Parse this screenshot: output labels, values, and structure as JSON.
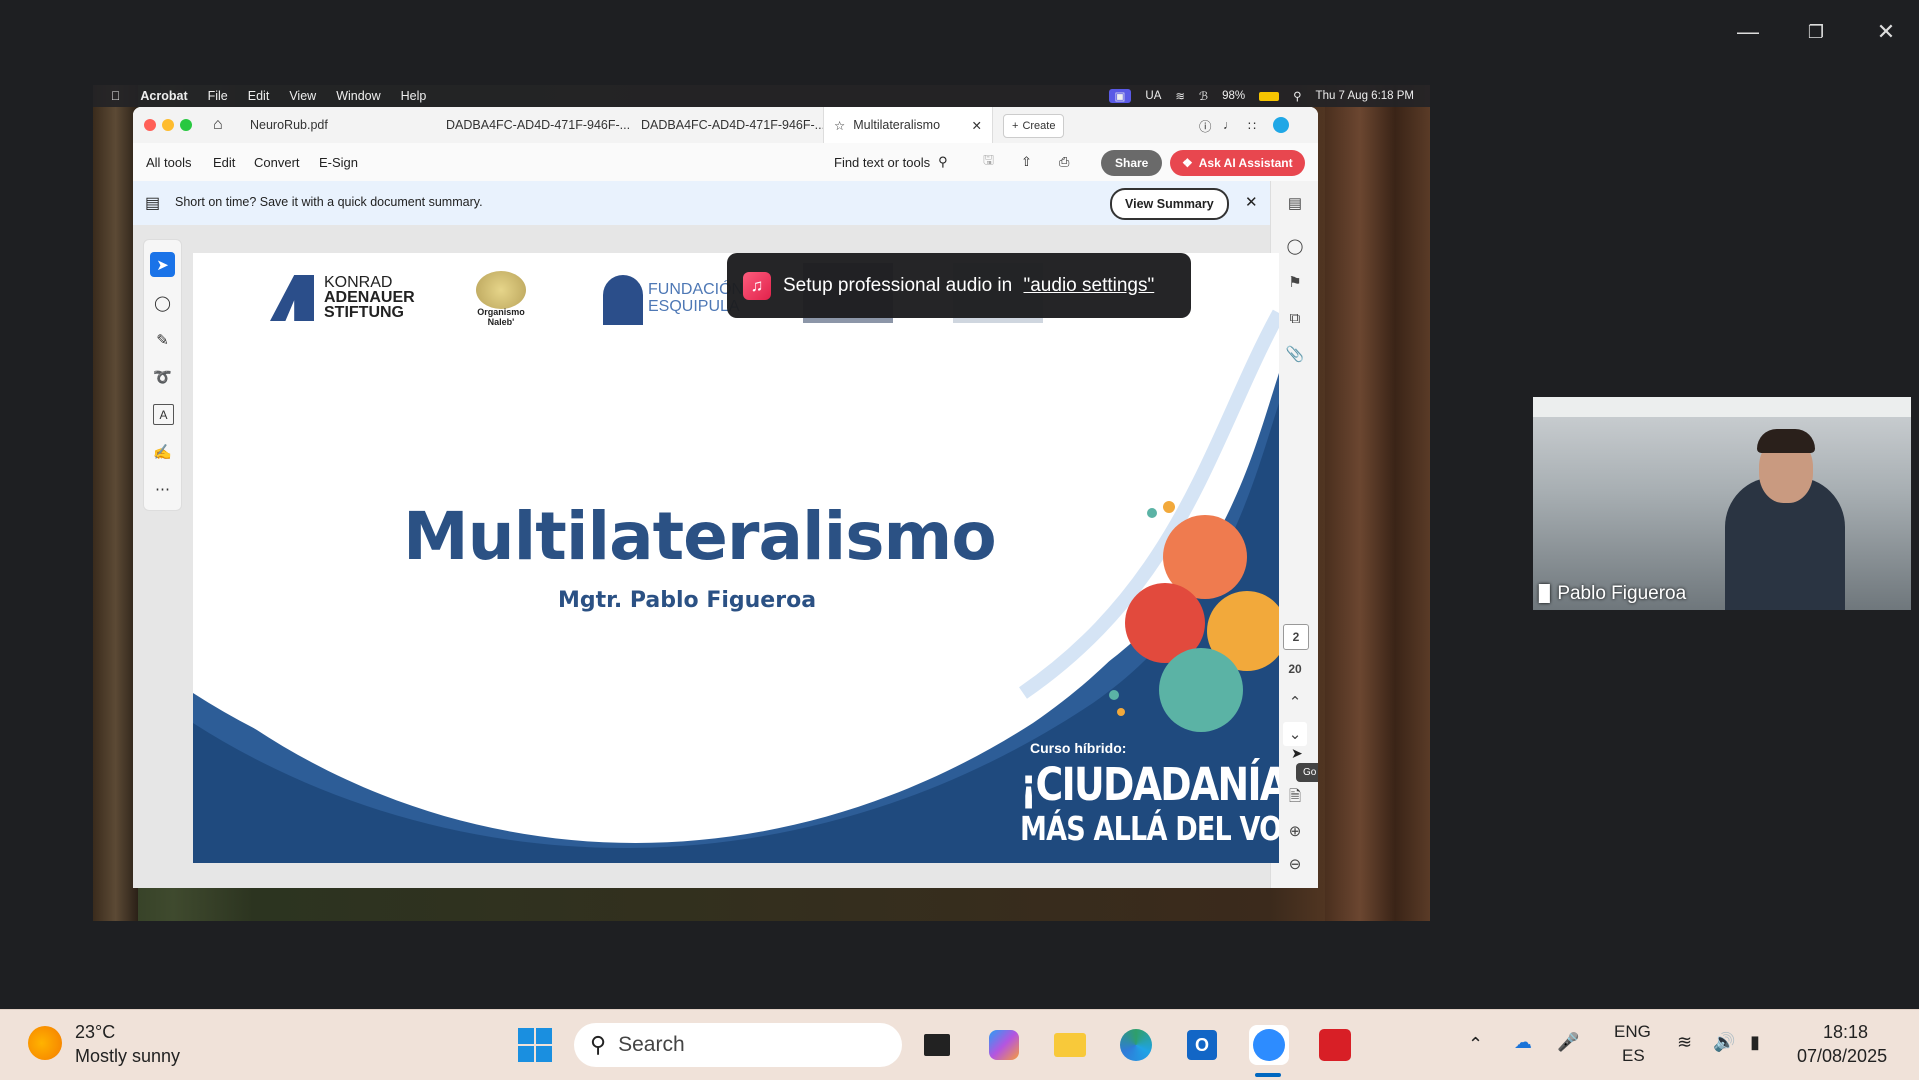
{
  "zoom_window": {
    "controls": {
      "minimize": "minimize-icon",
      "restore": "restore-icon",
      "close": "close-icon"
    }
  },
  "mac_menubar": {
    "items": [
      "Acrobat",
      "File",
      "Edit",
      "View",
      "Window",
      "Help"
    ],
    "status": {
      "flag": "UA",
      "battery": "98%",
      "datetime": "Thu 7 Aug  6:18 PM"
    }
  },
  "acrobat": {
    "tabs": [
      {
        "label": "NeuroRub.pdf"
      },
      {
        "label": "DADBA4FC-AD4D-471F-946F-..."
      },
      {
        "label": "DADBA4FC-AD4D-471F-946F-..."
      },
      {
        "label": "Multilateralismo"
      }
    ],
    "create_label": "Create",
    "toolbar": {
      "menu": [
        "All tools",
        "Edit",
        "Convert",
        "E-Sign"
      ],
      "find_label": "Find text or tools",
      "share_label": "Share",
      "ai_label": "Ask AI Assistant"
    },
    "summary_bar": {
      "message": "Short on time? Save it with a quick document summary.",
      "button": "View Summary"
    },
    "page_nav": {
      "current_page": "2",
      "total_pages": "20",
      "tooltip": "Go to next page (→)"
    }
  },
  "slide": {
    "logos": {
      "konrad": [
        "KONRAD",
        "ADENAUER",
        "STIFTUNG"
      ],
      "naleb": [
        "Organismo",
        "Naleb'"
      ],
      "fundacion": [
        "FUNDACIÓN",
        "ESQUIPULA"
      ]
    },
    "title": "Multilateralismo",
    "subtitle": "Mgtr. Pablo Figueroa",
    "course_label": "Curso híbrido:",
    "course_title_1": "¡CIUDADANÍA",
    "course_title_2": "MÁS ALLÁ DEL VOTO!",
    "colors": {
      "title": "#2b5184",
      "wave": "#2d5d97"
    }
  },
  "toast": {
    "text": "Setup professional audio in ",
    "link": "\"audio settings\""
  },
  "participant": {
    "name": "Pablo Figueroa"
  },
  "taskbar": {
    "weather": {
      "temp": "23°C",
      "condition": "Mostly sunny"
    },
    "search_placeholder": "Search",
    "apps": [
      "start-icon",
      "task-view-icon",
      "copilot-icon",
      "file-explorer-icon",
      "edge-icon",
      "outlook-icon",
      "zoom-icon",
      "acrobat-icon"
    ],
    "language": {
      "line1": "ENG",
      "line2": "ES"
    },
    "clock": {
      "time": "18:18",
      "date": "07/08/2025"
    }
  }
}
